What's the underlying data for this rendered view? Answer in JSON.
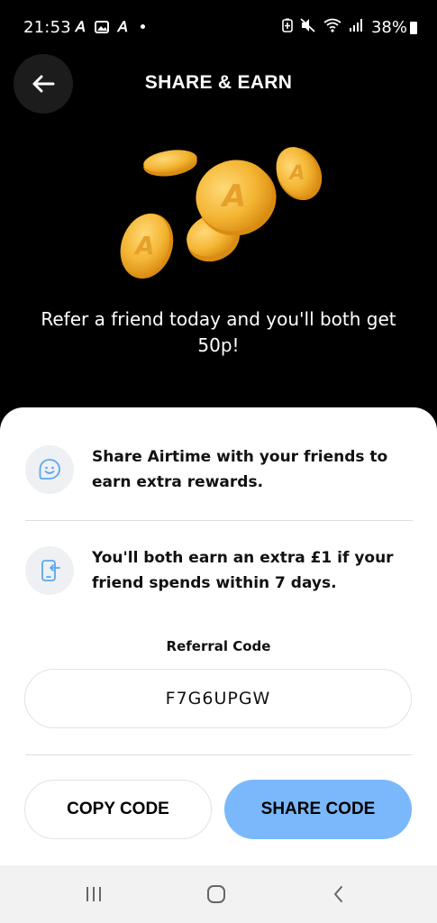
{
  "status_bar": {
    "time": "21:53",
    "battery": "38%",
    "icons": [
      "airtime-a-icon",
      "gallery-icon",
      "airtime-a-icon",
      "notification-dot",
      "battery-saver-icon",
      "mute-icon",
      "wifi-icon",
      "signal-icon",
      "battery-icon"
    ]
  },
  "header": {
    "title": "SHARE & EARN",
    "back_icon": "arrow-left-icon"
  },
  "hero": {
    "text": "Refer a friend today and you'll both get 50p!",
    "art": "gold-coins-illustration",
    "coin_color": "#f2b332"
  },
  "info": [
    {
      "icon": "smiley-icon",
      "text": "Share Airtime with your friends to earn extra rewards."
    },
    {
      "icon": "phone-transfer-icon",
      "text": "You'll both earn an extra £1 if your friend spends within 7 days."
    }
  ],
  "referral": {
    "label": "Referral Code",
    "code": "F7G6UPGW"
  },
  "actions": {
    "copy_label": "COPY CODE",
    "share_label": "SHARE CODE",
    "share_color": "#7bb8fb"
  },
  "nav": {
    "recents_icon": "recents-icon",
    "home_icon": "home-icon",
    "back_icon": "back-chevron-icon"
  }
}
